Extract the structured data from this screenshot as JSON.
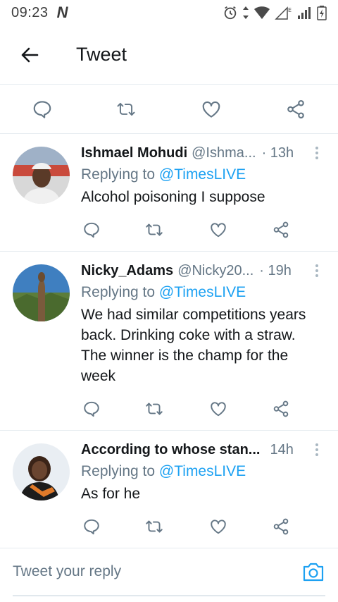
{
  "status_bar": {
    "time": "09:23",
    "n_logo": "N"
  },
  "app_bar": {
    "title": "Tweet"
  },
  "replies": [
    {
      "name": "Ishmael Mohudi",
      "handle": "@Ishma...",
      "time": "· 13h",
      "replying_prefix": "Replying to ",
      "replying_to": "@TimesLIVE",
      "text_lines": [
        "Alcohol poisoning I suppose"
      ]
    },
    {
      "name": "Nicky_Adams",
      "handle": "@Nicky20...",
      "time": "· 19h",
      "replying_prefix": "Replying to ",
      "replying_to": "@TimesLIVE",
      "text_lines": [
        "We had similar competitions years",
        "back. Drinking coke with a straw.",
        "The winner is the champ for the",
        "week"
      ]
    },
    {
      "name": "According to whose stan...",
      "handle": "",
      "time": "14h",
      "replying_prefix": "Replying to ",
      "replying_to": "@TimesLIVE",
      "text_lines": [
        "As for he"
      ]
    }
  ],
  "composer": {
    "placeholder": "Tweet your reply"
  },
  "colors": {
    "accent": "#1da1f2",
    "secondary_text": "#657786",
    "icon": "#657786",
    "divider": "#e6ecf0"
  },
  "icons": [
    "arrow-left-icon",
    "reply-icon",
    "retweet-icon",
    "like-icon",
    "share-icon",
    "more-vertical-icon",
    "camera-icon"
  ]
}
